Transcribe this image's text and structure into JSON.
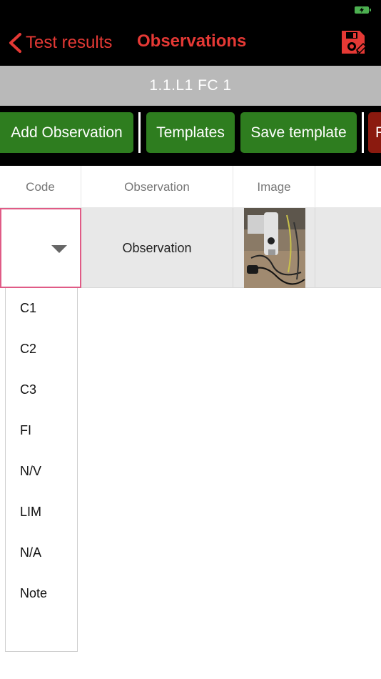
{
  "nav": {
    "back_label": "Test results",
    "title": "Observations",
    "colors": {
      "accent": "#e53935",
      "background": "#000000"
    }
  },
  "location": {
    "label": "1.1.L1 FC 1"
  },
  "toolbar": {
    "add_observation": "Add Observation",
    "templates": "Templates",
    "save_template": "Save template",
    "partial_red_label": "F",
    "colors": {
      "green": "#2e7d1f",
      "red": "#8b1a0f"
    }
  },
  "table": {
    "headers": {
      "code": "Code",
      "observation": "Observation",
      "image": "Image"
    },
    "rows": [
      {
        "code": "",
        "observation": "Observation",
        "image": "photo-thumbnail"
      }
    ]
  },
  "code_dropdown": {
    "options": [
      "C1",
      "C2",
      "C3",
      "FI",
      "N/V",
      "LIM",
      "N/A",
      "Note"
    ],
    "highlight_color": "#e05b86"
  },
  "icons": {
    "back": "chevron-left-icon",
    "save": "floppy-disk-edit-icon",
    "battery": "battery-charging-icon",
    "caret": "caret-down-icon"
  }
}
